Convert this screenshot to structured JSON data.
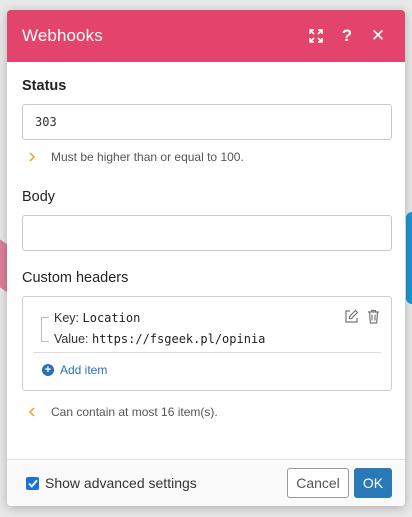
{
  "dialog": {
    "title": "Webhooks",
    "header_color": "#e2446b"
  },
  "status": {
    "label": "Status",
    "value": "303",
    "hint": "Must be higher than or equal to 100."
  },
  "body_field": {
    "label": "Body",
    "value": ""
  },
  "custom_headers": {
    "label": "Custom headers",
    "items": [
      {
        "key_label": "Key:",
        "key": "Location",
        "value_label": "Value:",
        "value": "https://fsgeek.pl/opinia"
      }
    ],
    "add_item_label": "Add item",
    "hint": "Can contain at most 16 item(s)."
  },
  "footer": {
    "advanced_label": "Show advanced settings",
    "advanced_checked": true,
    "cancel_label": "Cancel",
    "ok_label": "OK"
  },
  "icons": [
    "expand-icon",
    "help-icon",
    "close-icon",
    "edit-icon",
    "trash-icon",
    "plus-circle-icon",
    "chevron-right-icon",
    "chevron-left-icon",
    "checkmark-icon"
  ]
}
